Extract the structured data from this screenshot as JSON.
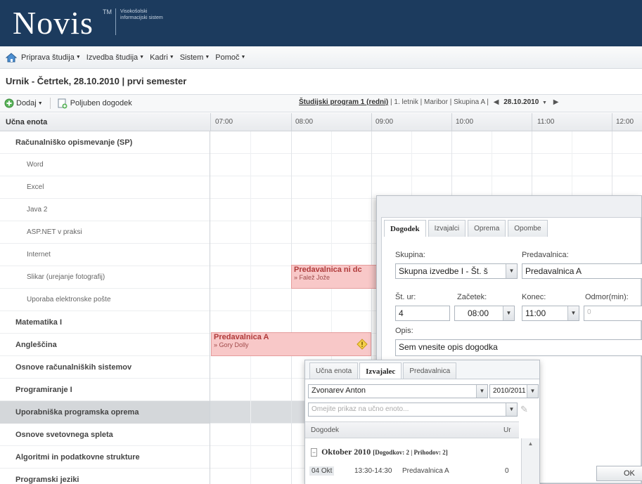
{
  "header": {
    "logo": "Novis",
    "trademark": "TM",
    "subtitle": "Visokošolski informacijski sistem"
  },
  "menu": {
    "items": [
      "Priprava študija",
      "Izvedba študija",
      "Kadri",
      "Sistem",
      "Pomoč"
    ]
  },
  "page_title": "Urnik - Četrtek, 28.10.2010 | prvi semester",
  "toolbar": {
    "add_label": "Dodaj",
    "event_label": "Poljuben dogodek",
    "program": "Študijski program 1 (redni)",
    "details": "| 1. letnik | Maribor | Skupina A |",
    "date": "28.10.2010"
  },
  "scheduler": {
    "unit_header": "Učna enota",
    "hours": [
      "07:00",
      "08:00",
      "09:00",
      "10:00",
      "11:00",
      "12:00"
    ],
    "rows": [
      {
        "label": "Računalniško opismevanje (SP)",
        "kind": "parent"
      },
      {
        "label": "Word",
        "kind": "sub"
      },
      {
        "label": "Excel",
        "kind": "sub"
      },
      {
        "label": "Java 2",
        "kind": "sub"
      },
      {
        "label": "ASP.NET v praksi",
        "kind": "sub"
      },
      {
        "label": "Internet",
        "kind": "sub"
      },
      {
        "label": "Slikar (urejanje fotografij)",
        "kind": "sub"
      },
      {
        "label": "Uporaba elektronske pošte",
        "kind": "sub"
      },
      {
        "label": "Matematika I",
        "kind": "parent"
      },
      {
        "label": "Angleščina",
        "kind": "parent"
      },
      {
        "label": "Osnove računalniških sistemov",
        "kind": "parent"
      },
      {
        "label": "Programiranje I",
        "kind": "parent"
      },
      {
        "label": "Uporabniška programska oprema",
        "kind": "selected"
      },
      {
        "label": "Osnove svetovnega spleta",
        "kind": "parent"
      },
      {
        "label": "Algoritmi in podatkovne strukture",
        "kind": "parent"
      },
      {
        "label": "Programski jeziki",
        "kind": "parent"
      }
    ],
    "events": [
      {
        "title": "Predavalnica ni dc",
        "person": "» Falež Jože"
      },
      {
        "title": "Predavalnica A",
        "person": "» Gory Dolly"
      }
    ]
  },
  "dialog_event": {
    "tabs": [
      "Dogodek",
      "Izvajalci",
      "Oprema",
      "Opombe"
    ],
    "skupina_label": "Skupina:",
    "skupina_value": "Skupna izvedbe I - Št. š",
    "predavalnica_label": "Predavalnica:",
    "predavalnica_value": "Predavalnica A",
    "st_ur_label": "Št. ur:",
    "st_ur_value": "4",
    "zacetek_label": "Začetek:",
    "zacetek_value": "08:00",
    "konec_label": "Konec:",
    "konec_value": "11:00",
    "odmor_label": "Odmor(min):",
    "odmor_value": "0",
    "opis_label": "Opis:",
    "opis_value": "Sem vnesite opis dogodka",
    "ok_label": "OK"
  },
  "dialog_teacher": {
    "tabs": [
      "Učna enota",
      "Izvajalec",
      "Predavalnica"
    ],
    "teacher": "Zvonarev Anton",
    "year": "2010/2011",
    "filter_placeholder": "Omejite prikaz na učno enoto...",
    "col_event": "Dogodek",
    "col_hours": "Ur",
    "group_title": "Oktober 2010",
    "group_meta": "[Dogodkov: 2 | Prihodov: 2]",
    "event_day": "04 Okt",
    "event_time": "13:30-14:30",
    "event_room": "Predavalnica A",
    "event_hours": "0"
  }
}
